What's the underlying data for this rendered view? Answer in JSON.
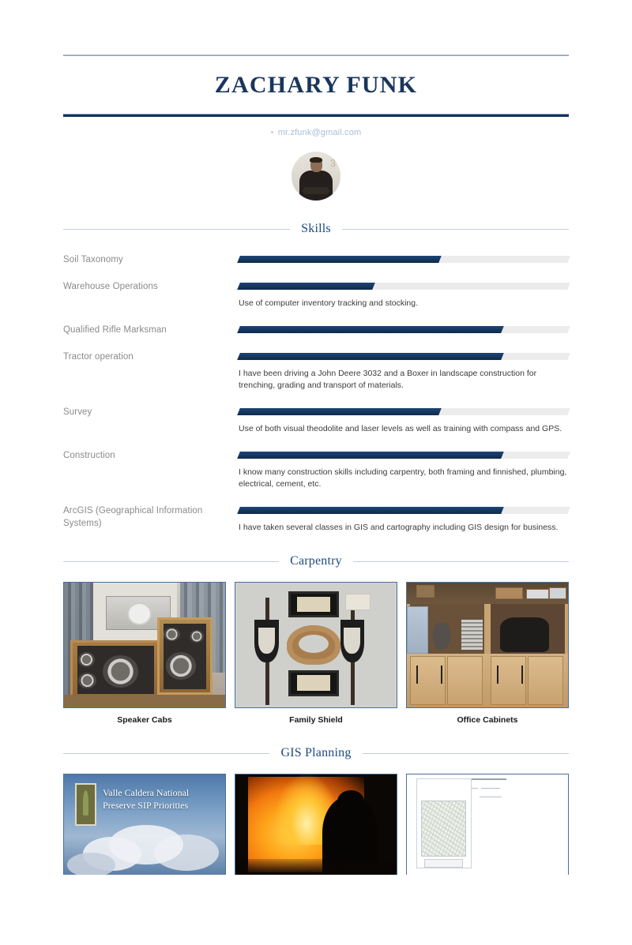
{
  "header": {
    "name": "ZACHARY FUNK",
    "contact": {
      "bullet_icon": "dot-bullet-icon",
      "email": "mr.zfunk@gmail.com"
    },
    "avatar_alt": "profile-photo",
    "avatar_bg_text": "3"
  },
  "colors": {
    "accent_navy": "#12325e",
    "heading_blue": "#1b4a85",
    "bar_fill": "#16365d",
    "bar_track": "#ececec",
    "label_gray": "#8a8a8a",
    "contact_blue": "#a8bdd8",
    "image_border": "#4a6f9c"
  },
  "sections": [
    {
      "id": "skills",
      "title": "Skills"
    },
    {
      "id": "carpentry",
      "title": "Carpentry"
    },
    {
      "id": "gis",
      "title": "GIS Planning"
    }
  ],
  "skills": [
    {
      "name": "Soil Taxonomy",
      "level_percent": 61,
      "description": ""
    },
    {
      "name": "Warehouse Operations",
      "level_percent": 41,
      "description": "Use of computer inventory tracking and stocking."
    },
    {
      "name": "Qualified Rifle Marksman",
      "level_percent": 80,
      "description": ""
    },
    {
      "name": "Tractor operation",
      "level_percent": 80,
      "description": "I have been driving a John Deere 3032 and a Boxer in landscape construction for trenching, grading and transport of materials."
    },
    {
      "name": "Survey",
      "level_percent": 61,
      "description": "Use of both visual theodolite and laser levels as well as training with compass and GPS."
    },
    {
      "name": "Construction",
      "level_percent": 80,
      "description": "I know many construction skills including carpentry, both framing and finnished, plumbing, electrical, cement, etc."
    },
    {
      "name": "ArcGIS (Geographical Information Systems)",
      "level_percent": 80,
      "description": "I have taken several classes in GIS and cartography including GIS design for business."
    }
  ],
  "carpentry_gallery": [
    {
      "caption": "Speaker Cabs",
      "image_name": "speaker-cabinets-photo"
    },
    {
      "caption": "Family Shield",
      "image_name": "family-shield-photo"
    },
    {
      "caption": "Office Cabinets",
      "image_name": "office-cabinets-photo"
    }
  ],
  "gis_gallery": [
    {
      "caption": "",
      "image_name": "valle-caldera-title-slide",
      "title_text": "Valle Caldera National Preserve SIP Priorities"
    },
    {
      "caption": "",
      "image_name": "wildfire-photo"
    },
    {
      "caption": "",
      "image_name": "gis-map-document"
    }
  ]
}
